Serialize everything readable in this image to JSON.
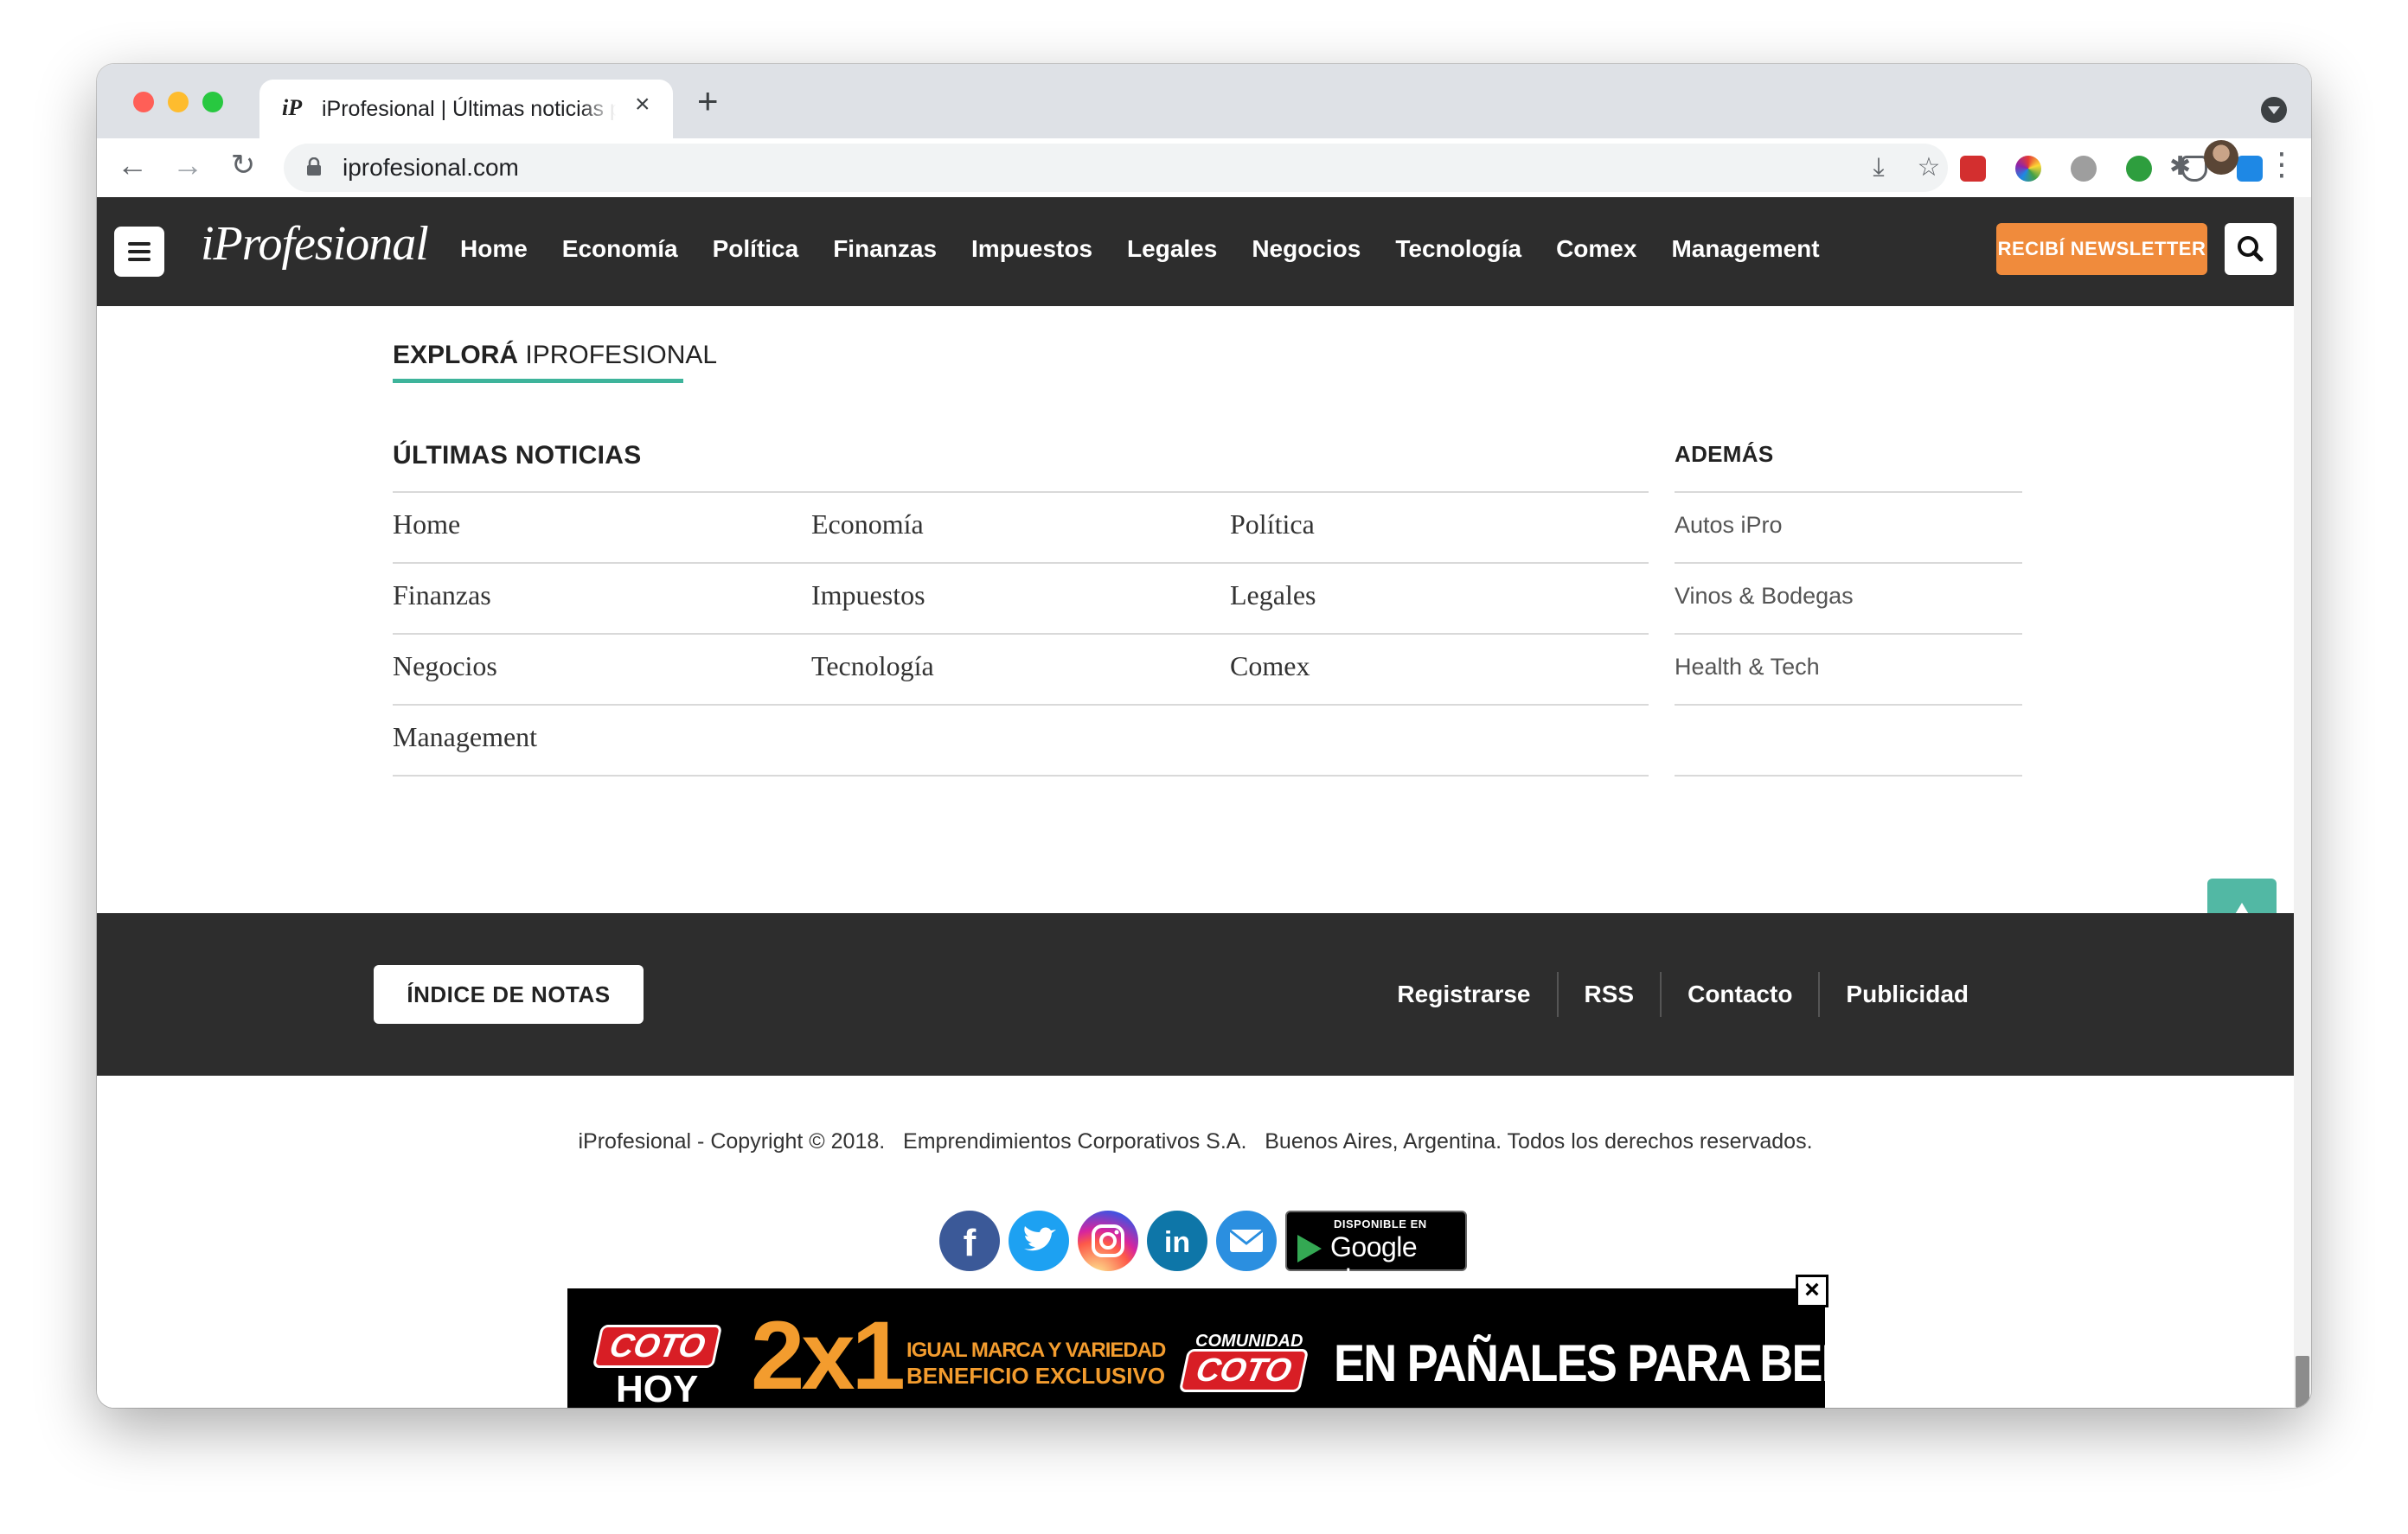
{
  "browser": {
    "tab_title": "iProfesional | Últimas noticias p",
    "tab_favicon": "iP",
    "url": "iprofesional.com",
    "new_tab_label": "+"
  },
  "header": {
    "logo": "iProfesional",
    "nav": [
      "Home",
      "Economía",
      "Política",
      "Finanzas",
      "Impuestos",
      "Legales",
      "Negocios",
      "Tecnología",
      "Comex",
      "Management"
    ],
    "newsletter_label": "RECIBÍ NEWSLETTER"
  },
  "explore": {
    "title_bold": "EXPLORÁ",
    "title_rest": " IPROFESIONAL"
  },
  "latest": {
    "title": "ÚLTIMAS NOTICIAS",
    "links": [
      "Home",
      "Economía",
      "Política",
      "Finanzas",
      "Impuestos",
      "Legales",
      "Negocios",
      "Tecnología",
      "Comex",
      "Management"
    ]
  },
  "extras": {
    "title": "ADEMÁS",
    "links": [
      "Autos iPro",
      "Vinos & Bodegas",
      "Health & Tech"
    ]
  },
  "footer": {
    "indice_label": "ÍNDICE DE NOTAS",
    "links": [
      "Registrarse",
      "RSS",
      "Contacto",
      "Publicidad"
    ],
    "copyright": "iProfesional - Copyright © 2018.   Emprendimientos Corporativos S.A.   Buenos Aires, Argentina. Todos los derechos reservados.",
    "social": [
      "facebook-icon",
      "twitter-icon",
      "instagram-icon",
      "linkedin-icon",
      "email-icon"
    ],
    "gplay_small": "DISPONIBLE EN",
    "gplay_big": "Google play"
  },
  "ad": {
    "coto": "COTO",
    "hoy": "HOY",
    "promo": "2x1",
    "line1": "IGUAL MARCA Y VARIEDAD",
    "line2": "BENEFICIO EXCLUSIVO",
    "comunidad": "COMUNIDAD",
    "coto2": "COTO",
    "headline": "EN PAÑALES PARA BEBÉS",
    "close": "×"
  },
  "colors": {
    "header_bg": "#2d2d2d",
    "accent_teal": "#3eb49b",
    "newsletter_orange": "#f08b3c"
  }
}
